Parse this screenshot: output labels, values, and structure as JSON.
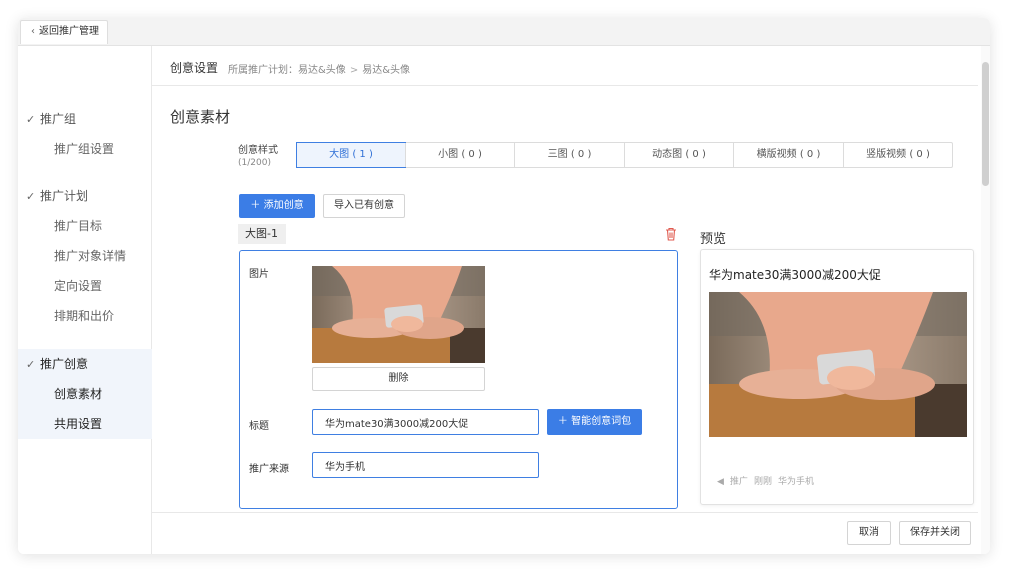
{
  "topbar": {
    "back_label": "返回推广管理"
  },
  "sidebar": {
    "groups": [
      {
        "label": "推广组",
        "items": [
          "推广组设置"
        ]
      },
      {
        "label": "推广计划",
        "items": [
          "推广目标",
          "推广对象详情",
          "定向设置",
          "排期和出价"
        ]
      },
      {
        "label": "推广创意",
        "items": [
          "创意素材",
          "共用设置"
        ]
      }
    ]
  },
  "header": {
    "title": "创意设置",
    "path_prefix": "所属推广计划：易达&头像",
    "path_sep": ">",
    "path_current": "易达&头像"
  },
  "section": {
    "title": "创意素材",
    "style_label": "创意样式",
    "style_count": "(1/200)",
    "tabs": [
      "大图 ( 1 )",
      "小图 ( 0 )",
      "三图 ( 0 )",
      "动态图 ( 0 )",
      "横版视频 ( 0 )",
      "竖版视频 ( 0 )"
    ],
    "active_tab": 0,
    "add_button": "添加创意",
    "import_button": "导入已有创意"
  },
  "card": {
    "tag": "大图-1",
    "image_label": "图片",
    "delete_label": "删除",
    "title_label": "标题",
    "title_value": "华为mate30满3000减200大促",
    "smart_button": "智能创意词包",
    "source_label": "推广来源",
    "source_value": "华为手机"
  },
  "preview": {
    "heading": "预览",
    "headline": "华为mate30满3000减200大促",
    "meta_ad": "推广",
    "meta_time": "刚刚",
    "meta_source": "华为手机"
  },
  "footer": {
    "cancel": "取消",
    "save_close": "保存并关闭"
  },
  "icons": {
    "back": "chevron-left-icon",
    "check": "check-icon",
    "plus": "plus-icon",
    "trash": "trash-icon",
    "speaker": "speaker-icon"
  },
  "colors": {
    "primary": "#3b7de6",
    "active_bg": "#f1f5fb",
    "delete_red": "#e05a4f"
  }
}
